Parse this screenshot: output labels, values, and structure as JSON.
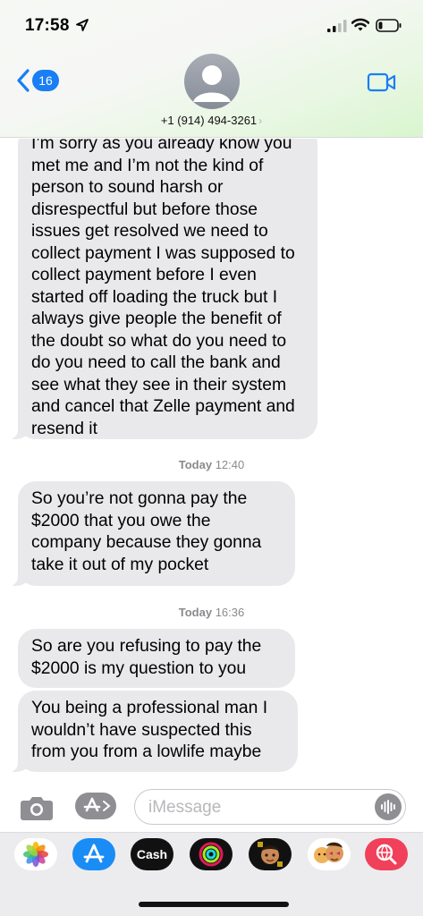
{
  "status_bar": {
    "time": "17:58",
    "location_icon": "location-arrow-icon",
    "signal_icon": "cellular-signal-icon",
    "wifi_icon": "wifi-icon",
    "battery_icon": "battery-icon"
  },
  "header": {
    "back_count": "16",
    "contact": "+1 (914) 494-3261",
    "contact_chevron": "›",
    "back_icon": "chevron-left-icon",
    "video_icon": "video-camera-icon",
    "accent_color": "#1a7ef5"
  },
  "messages": [
    {
      "type": "received",
      "text": "I’m sorry as you already know you met me and I’m not the kind of person to sound harsh or disrespectful but before those issues get resolved we need to collect payment I was supposed to collect payment before I even started off loading the truck but I always give people the benefit of the doubt so what do you need to do you need to call the bank and see what they see in their system and cancel that Zelle payment and resend it"
    },
    {
      "type": "timestamp",
      "day": "Today",
      "time": "12:40"
    },
    {
      "type": "received",
      "text": "So you’re not gonna pay the $2000 that you owe the company because they gonna take it out of my pocket"
    },
    {
      "type": "timestamp",
      "day": "Today",
      "time": "16:36"
    },
    {
      "type": "received",
      "text": "So are you refusing to pay the $2000 is my question to you"
    },
    {
      "type": "received",
      "text": "You being a professional man I wouldn’t have suspected this from you from a lowlife maybe"
    }
  ],
  "input_bar": {
    "placeholder": "iMessage",
    "camera_icon": "camera-icon",
    "apps_icon": "app-store-icon",
    "audio_icon": "audio-waveform-icon"
  },
  "app_drawer": {
    "apps": [
      {
        "name": "photos-icon",
        "label": ""
      },
      {
        "name": "app-store-icon",
        "label": ""
      },
      {
        "name": "apple-cash-icon",
        "label": "Cash"
      },
      {
        "name": "activity-rings-icon",
        "label": ""
      },
      {
        "name": "memoji-icon",
        "label": ""
      },
      {
        "name": "animoji-icon",
        "label": ""
      },
      {
        "name": "web-search-icon",
        "label": ""
      }
    ]
  }
}
